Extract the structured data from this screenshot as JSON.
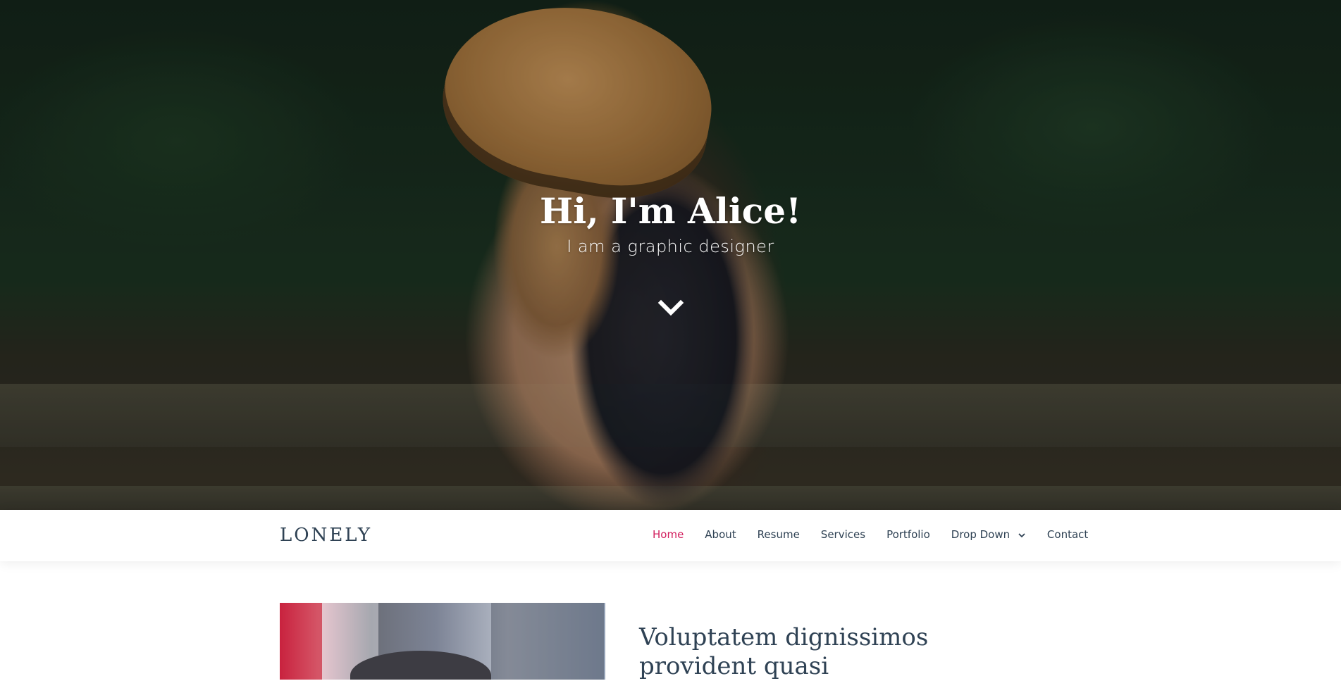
{
  "hero": {
    "title": "Hi, I'm Alice!",
    "subtitle": "I am a graphic designer",
    "scroll_icon": "chevron-down-icon"
  },
  "nav": {
    "logo": "LONELY",
    "items": [
      {
        "label": "Home",
        "active": true
      },
      {
        "label": "About",
        "active": false
      },
      {
        "label": "Resume",
        "active": false
      },
      {
        "label": "Services",
        "active": false
      },
      {
        "label": "Portfolio",
        "active": false
      },
      {
        "label": "Drop Down",
        "active": false,
        "icon": "chevron-down-icon"
      },
      {
        "label": "Contact",
        "active": false
      }
    ],
    "active_color": "#d21f5e",
    "text_color": "#2f4254"
  },
  "about": {
    "title": "Voluptatem dignissimos provident quasi"
  }
}
